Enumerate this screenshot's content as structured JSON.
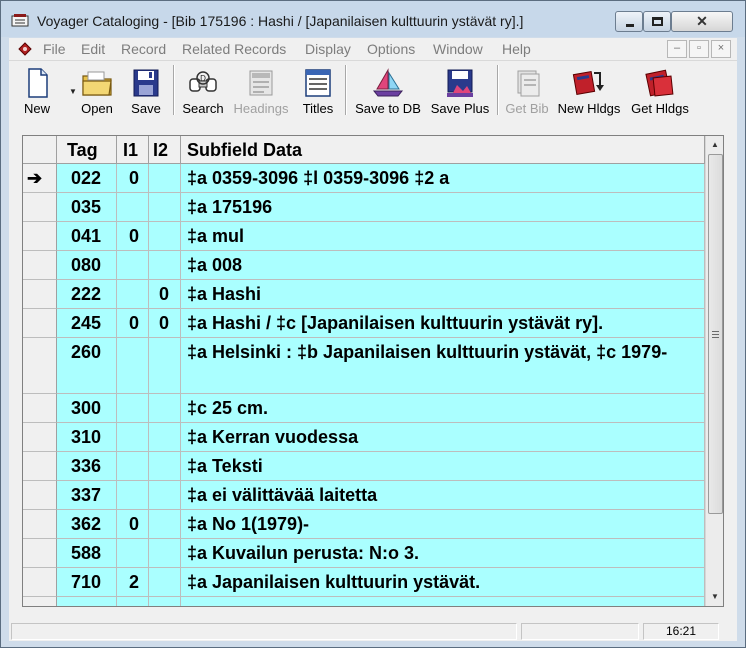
{
  "window": {
    "title": "Voyager Cataloging - [Bib 175196 : Hashi / [Japanilaisen kulttuurin ystävät ry].]",
    "close_glyph": "✕"
  },
  "menu": [
    "File",
    "Edit",
    "Record",
    "Related Records",
    "Display",
    "Options",
    "Window",
    "Help"
  ],
  "toolbar": [
    {
      "label": "New",
      "icon": "new-document-icon",
      "enabled": true
    },
    {
      "label": "Open",
      "icon": "folder-icon",
      "enabled": true
    },
    {
      "label": "Save",
      "icon": "floppy-disk-icon",
      "enabled": true
    },
    {
      "label": "Search",
      "icon": "search-binoculars-icon",
      "enabled": true
    },
    {
      "label": "Headings",
      "icon": "headings-icon",
      "enabled": false
    },
    {
      "label": "Titles",
      "icon": "titles-icon",
      "enabled": true
    },
    {
      "label": "Save to DB",
      "icon": "sailboat-icon",
      "enabled": true
    },
    {
      "label": "Save Plus",
      "icon": "save-plus-icon",
      "enabled": true
    },
    {
      "label": "Get Bib",
      "icon": "get-bib-icon",
      "enabled": false
    },
    {
      "label": "New Hldgs",
      "icon": "new-holdings-icon",
      "enabled": true
    },
    {
      "label": "Get Hldgs",
      "icon": "get-holdings-icon",
      "enabled": true
    }
  ],
  "grid": {
    "headers": {
      "tag": "Tag",
      "i1": "I1",
      "i2": "I2",
      "data": "Subfield Data"
    },
    "selected_marker": "➔",
    "rows": [
      {
        "tag": "022",
        "i1": "0",
        "i2": "",
        "data": "‡a 0359-3096 ‡l 0359-3096 ‡2 a"
      },
      {
        "tag": "035",
        "i1": "",
        "i2": "",
        "data": "‡a 175196"
      },
      {
        "tag": "041",
        "i1": "0",
        "i2": "",
        "data": "‡a mul"
      },
      {
        "tag": "080",
        "i1": "",
        "i2": "",
        "data": "‡a 008"
      },
      {
        "tag": "222",
        "i1": "",
        "i2": "0",
        "data": "‡a Hashi"
      },
      {
        "tag": "245",
        "i1": "0",
        "i2": "0",
        "data": "‡a Hashi / ‡c [Japanilaisen kulttuurin ystävät ry]."
      },
      {
        "tag": "260",
        "i1": "",
        "i2": "",
        "data": "‡a Helsinki : ‡b Japanilaisen kulttuurin ystävät, ‡c 1979-"
      },
      {
        "tag": "300",
        "i1": "",
        "i2": "",
        "data": "‡c 25 cm."
      },
      {
        "tag": "310",
        "i1": "",
        "i2": "",
        "data": "‡a Kerran vuodessa"
      },
      {
        "tag": "336",
        "i1": "",
        "i2": "",
        "data": "‡a Teksti"
      },
      {
        "tag": "337",
        "i1": "",
        "i2": "",
        "data": "‡a ei välittävää laitetta"
      },
      {
        "tag": "362",
        "i1": "0",
        "i2": "",
        "data": "‡a No 1(1979)-"
      },
      {
        "tag": "588",
        "i1": "",
        "i2": "",
        "data": "‡a Kuvailun perusta: N:o 3."
      },
      {
        "tag": "710",
        "i1": "2",
        "i2": "",
        "data": "‡a Japanilaisen kulttuurin ystävät."
      }
    ]
  },
  "status": {
    "time": "16:21"
  }
}
